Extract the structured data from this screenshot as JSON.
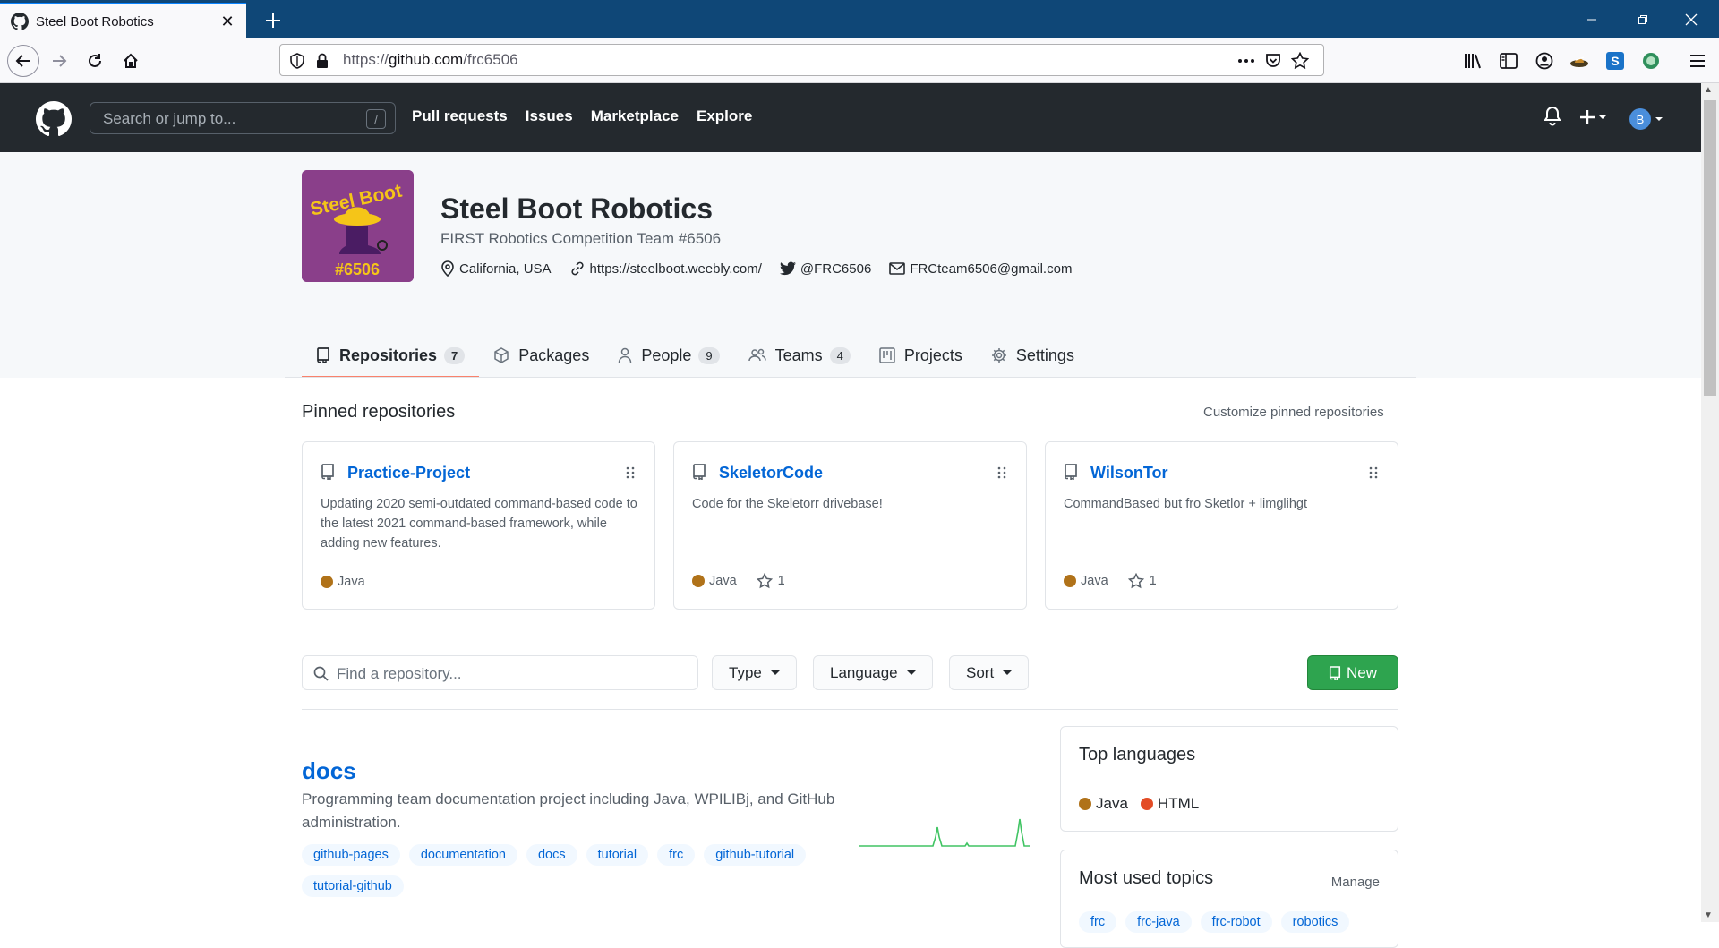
{
  "browser": {
    "tab_title": "Steel Boot Robotics",
    "url_scheme": "https://",
    "url_host": "github.com",
    "url_path": "/frc6506"
  },
  "github_header": {
    "search_placeholder": "Search or jump to...",
    "search_shortcut": "/",
    "nav": [
      "Pull requests",
      "Issues",
      "Marketplace",
      "Explore"
    ]
  },
  "org": {
    "avatar_text_top": "Steel Boot",
    "avatar_text_bottom": "#6506",
    "name": "Steel Boot Robotics",
    "description": "FIRST Robotics Competition Team #6506",
    "location": "California, USA",
    "website": "https://steelboot.weebly.com/",
    "twitter": "@FRC6506",
    "email": "FRCteam6506@gmail.com"
  },
  "tabs": [
    {
      "label": "Repositories",
      "count": "7",
      "icon": "repo-icon",
      "selected": true
    },
    {
      "label": "Packages",
      "count": null,
      "icon": "package-icon",
      "selected": false
    },
    {
      "label": "People",
      "count": "9",
      "icon": "person-icon",
      "selected": false
    },
    {
      "label": "Teams",
      "count": "4",
      "icon": "people-icon",
      "selected": false
    },
    {
      "label": "Projects",
      "count": null,
      "icon": "project-icon",
      "selected": false
    },
    {
      "label": "Settings",
      "count": null,
      "icon": "gear-icon",
      "selected": false
    }
  ],
  "pinned": {
    "title": "Pinned repositories",
    "customize": "Customize pinned repositories",
    "repos": [
      {
        "name": "Practice-Project",
        "description": "Updating 2020 semi-outdated command-based code to the latest 2021 command-based framework, while adding new features.",
        "language": "Java",
        "language_color": "#b07219",
        "stars": null
      },
      {
        "name": "SkeletorCode",
        "description": "Code for the Skeletorr drivebase!",
        "language": "Java",
        "language_color": "#b07219",
        "stars": "1"
      },
      {
        "name": "WilsonTor",
        "description": "CommandBased but fro Sketlor + limglihgt",
        "language": "Java",
        "language_color": "#b07219",
        "stars": "1"
      }
    ]
  },
  "filters": {
    "find_placeholder": "Find a repository...",
    "type": "Type",
    "language": "Language",
    "sort": "Sort",
    "new": "New"
  },
  "repos": [
    {
      "name": "docs",
      "description": "Programming team documentation project including Java, WPILIBj, and GitHub administration.",
      "topics": [
        "github-pages",
        "documentation",
        "docs",
        "tutorial",
        "frc",
        "github-tutorial",
        "tutorial-github"
      ]
    }
  ],
  "sidebar": {
    "top_languages_title": "Top languages",
    "languages": [
      {
        "name": "Java",
        "color": "#b07219"
      },
      {
        "name": "HTML",
        "color": "#e34c26"
      }
    ],
    "topics_title": "Most used topics",
    "manage": "Manage",
    "topics": [
      "frc",
      "frc-java",
      "frc-robot",
      "robotics"
    ]
  },
  "colors": {
    "header_bg": "#24292e",
    "link": "#0366d6",
    "tab_underline": "#f9826c",
    "new_button": "#2ea44f",
    "titlebar": "#0f4777"
  }
}
